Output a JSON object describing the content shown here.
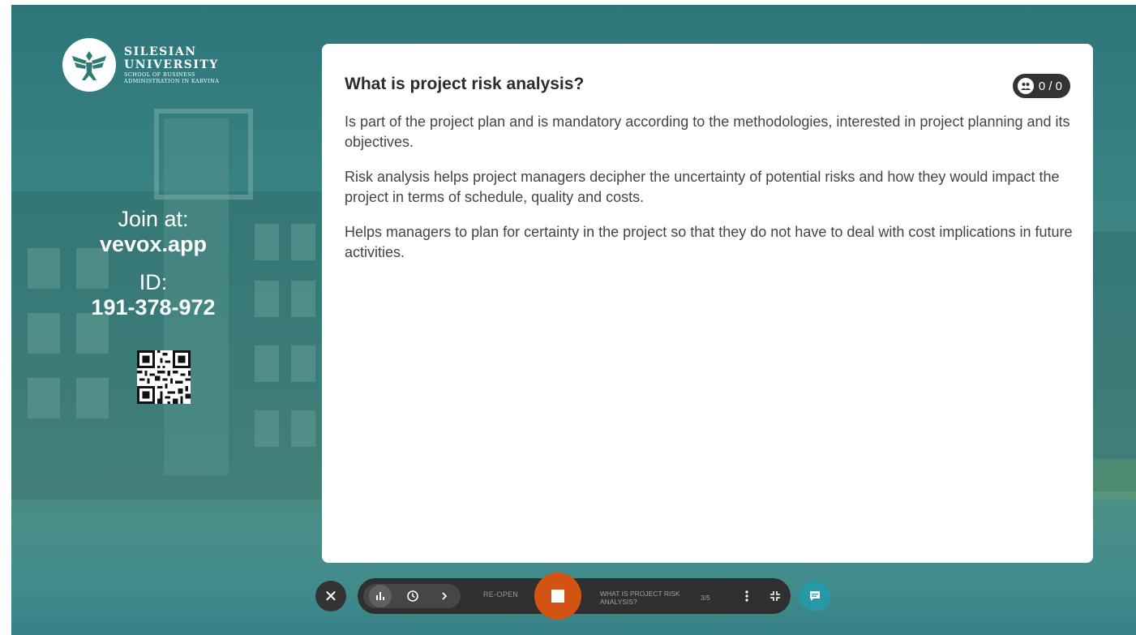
{
  "logo": {
    "line1": "SILESIAN",
    "line2": "UNIVERSITY",
    "line3": "SCHOOL OF BUSINESS",
    "line4": "ADMINISTRATION IN KARVINA"
  },
  "join": {
    "label": "Join at:",
    "host": "vevox.app",
    "id_label": "ID:",
    "id_value": "191-378-972"
  },
  "question": {
    "title": "What is project risk analysis?",
    "responses": "0 / 0",
    "paragraphs": [
      "Is part of the project plan and is mandatory according to the methodologies, interested in project planning and its objectives.",
      "Risk analysis helps project managers decipher the uncertainty of potential risks and how they would impact the project in terms of schedule, quality and costs.",
      "Helps managers to plan for certainty in the project so that they do not have to deal with cost implications in future activities."
    ]
  },
  "toolbar": {
    "reopen_label": "RE-OPEN",
    "question_name": "WHAT IS PROJECT RISK ANALYSIS?",
    "pager": "3/5"
  },
  "colors": {
    "background_teal": "#3a8383",
    "stop_orange": "#d25312",
    "chat_teal": "#2698a8",
    "toolbar_dark": "#2f2f2f"
  }
}
